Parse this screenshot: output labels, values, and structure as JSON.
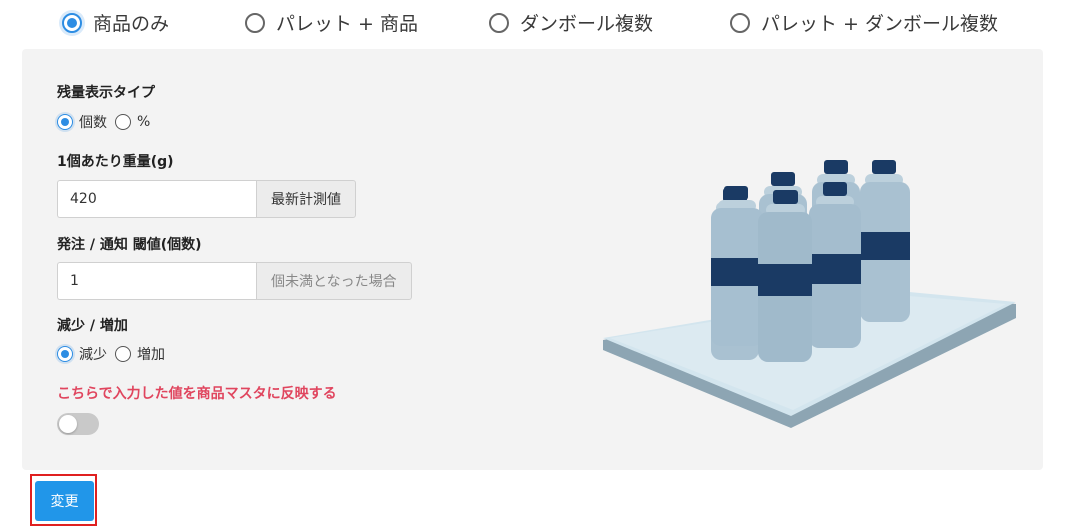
{
  "packaging_options": [
    {
      "label": "商品のみ",
      "selected": true
    },
    {
      "label": "パレット + 商品",
      "selected": false
    },
    {
      "label": "ダンボール複数",
      "selected": false
    },
    {
      "label": "パレット + ダンボール複数",
      "selected": false
    }
  ],
  "remaining_display": {
    "label": "残量表示タイプ",
    "options": [
      {
        "label": "個数",
        "selected": true
      },
      {
        "label": "%",
        "selected": false
      }
    ]
  },
  "unit_weight": {
    "label": "1個あたり重量(g)",
    "value": "420",
    "button_label": "最新計測値"
  },
  "threshold": {
    "label": "発注 / 通知 閾値(個数)",
    "value": "1",
    "suffix": "個未満となった場合"
  },
  "direction": {
    "label": "減少 / 増加",
    "options": [
      {
        "label": "減少",
        "selected": true
      },
      {
        "label": "増加",
        "selected": false
      }
    ]
  },
  "reflect_master": {
    "label": "こちらで入力した値を商品マスタに反映する",
    "enabled": false
  },
  "submit": {
    "label": "変更"
  },
  "colors": {
    "accent": "#2d8de3",
    "button": "#2196e9",
    "warning_text": "#e0455e",
    "highlight_border": "#e02020",
    "panel_bg": "#f3f3f3",
    "bottle_body": "#a9c1d1",
    "bottle_band": "#1a3a64"
  }
}
